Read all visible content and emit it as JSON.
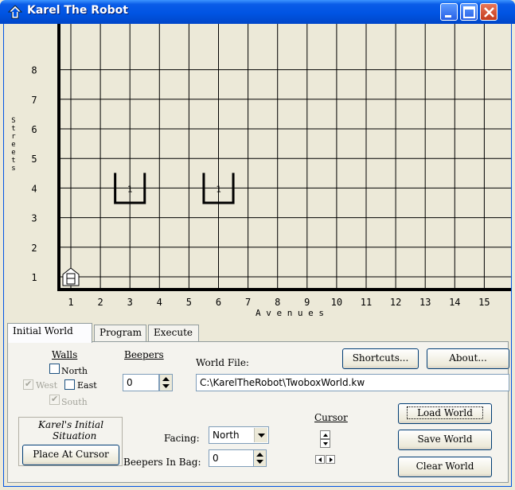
{
  "window": {
    "title": "Karel The Robot"
  },
  "world": {
    "streets_label": "Streets",
    "avenues_label": "A v e n u e s",
    "street_numbers": [
      "1",
      "2",
      "3",
      "4",
      "5",
      "6",
      "7",
      "8"
    ],
    "avenue_numbers": [
      "1",
      "2",
      "3",
      "4",
      "5",
      "6",
      "7",
      "8",
      "9",
      "10",
      "11",
      "12",
      "13",
      "14",
      "15"
    ],
    "boxes": [
      {
        "avenue": 3,
        "street": 4,
        "beepers": "1"
      },
      {
        "avenue": 6,
        "street": 4,
        "beepers": "1"
      }
    ],
    "robot": {
      "avenue": 1,
      "street": 1,
      "facing": "North"
    }
  },
  "tabs": [
    {
      "label": "Initial World",
      "active": true
    },
    {
      "label": "Program",
      "active": false
    },
    {
      "label": "Execute",
      "active": false
    }
  ],
  "walls": {
    "heading": "Walls",
    "north": "North",
    "west": "West",
    "east": "East",
    "south": "South"
  },
  "beepers": {
    "heading": "Beepers",
    "value": "0"
  },
  "world_file": {
    "label": "World File:",
    "value": "C:\\KarelTheRobot\\TwoboxWorld.kw"
  },
  "buttons": {
    "shortcuts": "Shortcuts...",
    "about": "About...",
    "load_world": "Load World",
    "save_world": "Save World",
    "clear_world": "Clear World",
    "place_at_cursor": "Place At Cursor"
  },
  "initial_situation": {
    "title_line1": "Karel's Initial",
    "title_line2": "Situation",
    "facing_label": "Facing:",
    "facing_value": "North",
    "beepers_in_bag_label": "Beepers In Bag:",
    "beepers_in_bag_value": "0"
  },
  "cursor": {
    "label": "Cursor"
  }
}
